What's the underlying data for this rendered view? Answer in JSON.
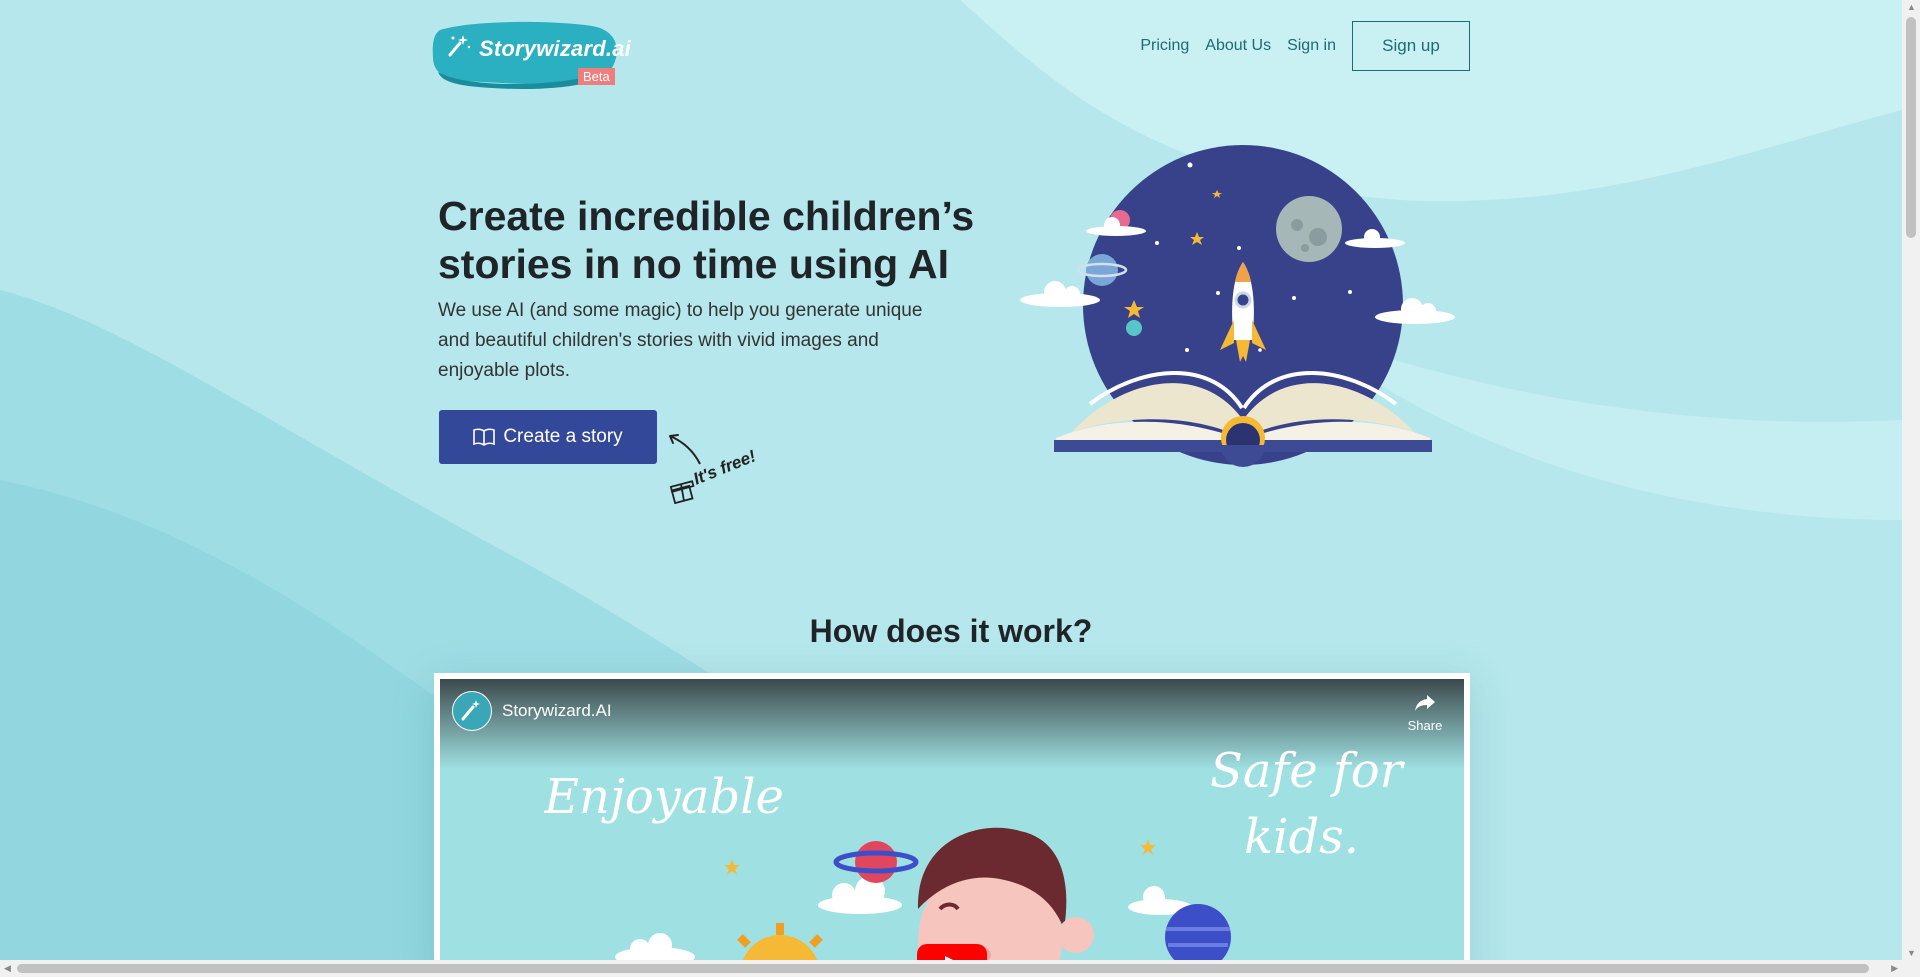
{
  "brand": {
    "name": "Storywizard.ai",
    "badge": "Beta"
  },
  "nav": {
    "items": [
      "Pricing",
      "About Us",
      "Sign in"
    ],
    "signup_label": "Sign up"
  },
  "hero": {
    "title": "Create incredible children’s stories in no time using AI",
    "subtitle": "We use AI (and some magic) to help you generate unique and beautiful children's stories with vivid images and enjoyable plots.",
    "cta_label": "Create a story",
    "note": "It's free!"
  },
  "how": {
    "title": "How does it work?"
  },
  "video": {
    "channel": "Storywizard.AI",
    "share_label": "Share",
    "frame_text_left": "Enjoyable",
    "frame_text_right_1": "Safe for",
    "frame_text_right_2": "kids."
  },
  "colors": {
    "background": "#b5e7ec",
    "accent": "#34489a",
    "nav_text": "#1f6b73",
    "badge": "#ee7d7d"
  },
  "icons": [
    "magic-wand-icon",
    "book-icon",
    "gift-icon",
    "share-icon",
    "play-icon"
  ]
}
